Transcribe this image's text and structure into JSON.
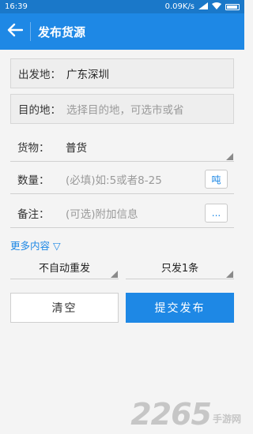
{
  "status_bar": {
    "time": "16:39",
    "net_speed": "0.09K/s",
    "icons": [
      "signal-icon",
      "wifi-icon",
      "battery-icon"
    ]
  },
  "app_bar": {
    "title": "发布货源",
    "back_icon": "arrow-left-icon"
  },
  "form": {
    "origin": {
      "label": "出发地：",
      "value": "广东深圳"
    },
    "destination": {
      "label": "目的地：",
      "placeholder": "选择目的地，可选市或省"
    },
    "cargo": {
      "label": "货物：",
      "value": "普货"
    },
    "quantity": {
      "label": "数量：",
      "placeholder": "(必填)如:5或者8-25",
      "unit": "吨"
    },
    "remark": {
      "label": "备注：",
      "placeholder": "(可选)附加信息",
      "more_button": "..."
    }
  },
  "more_content": "更多内容 ▽",
  "options": {
    "repost": "不自动重发",
    "count": "只发1条"
  },
  "buttons": {
    "clear": "清空",
    "submit": "提交发布"
  },
  "watermark": {
    "number": "2265",
    "site": "手游网"
  },
  "colors": {
    "primary": "#1e88e5",
    "status_bar": "#1a78c9"
  }
}
